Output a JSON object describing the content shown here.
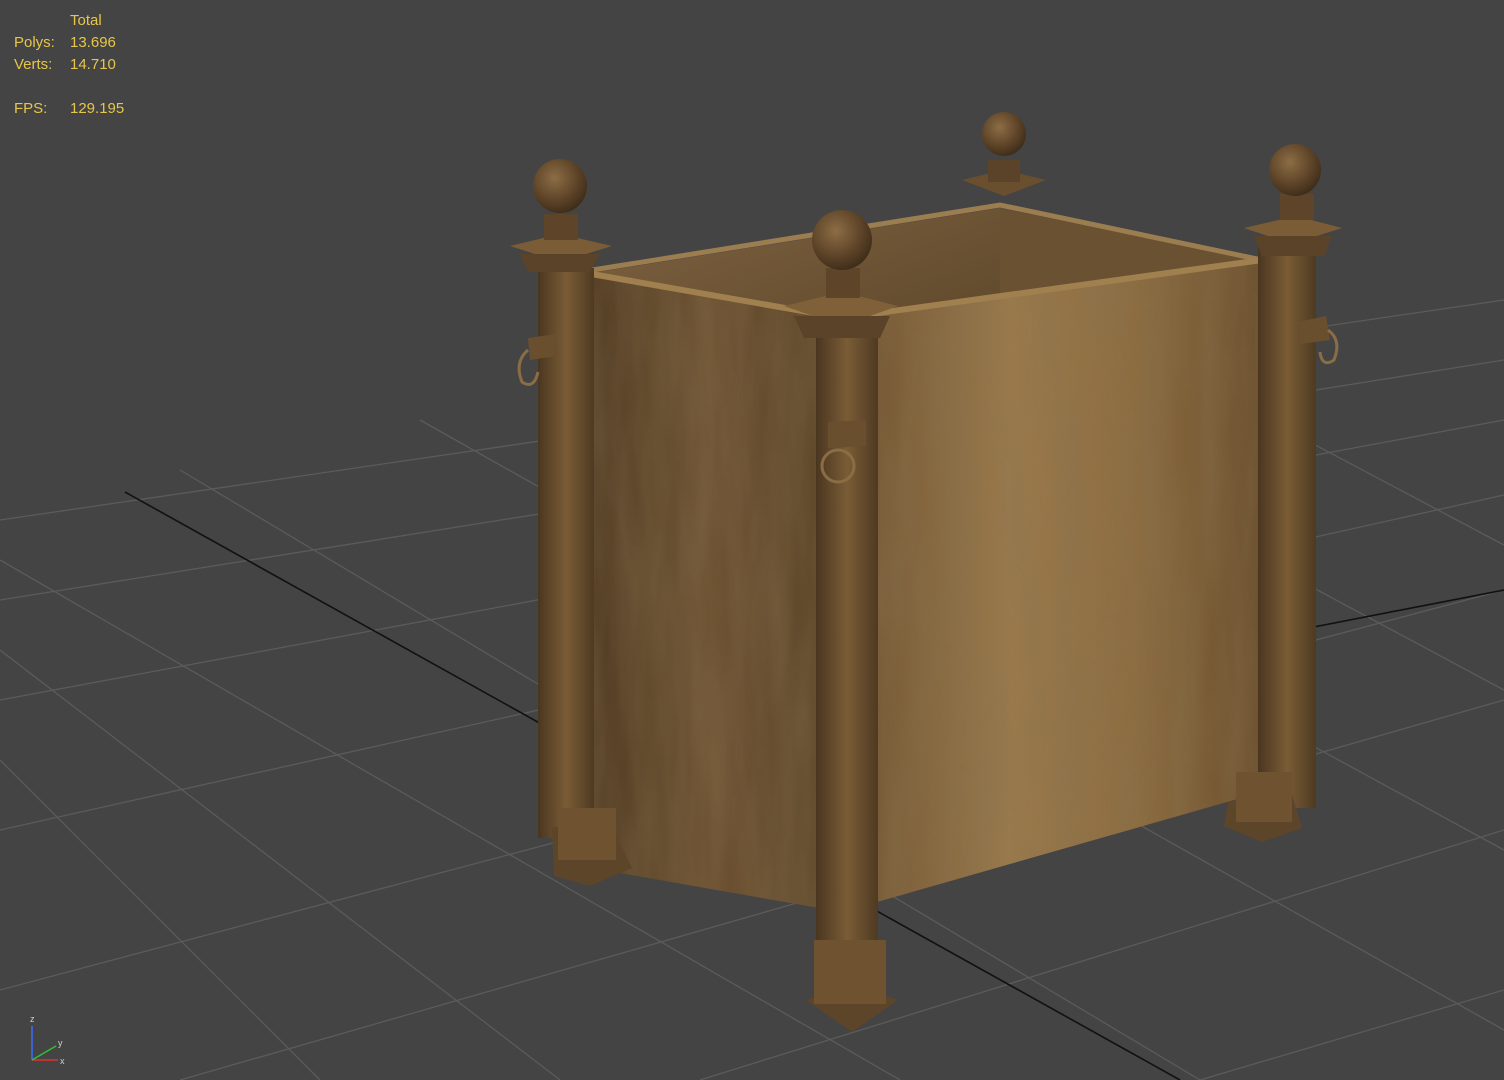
{
  "viewport": {
    "background": "#444444",
    "grid_color": "#5b5b5b",
    "grid_axis_color": "#111111",
    "text_color": "#e6c64a"
  },
  "stats": {
    "header": "Total",
    "polys_label": "Polys:",
    "polys_value": "13.696",
    "verts_label": "Verts:",
    "verts_value": "14.710",
    "fps_label": "FPS:",
    "fps_value": "129.195"
  },
  "axis_gizmo": {
    "z_label": "z",
    "x_label": "x",
    "y_label": "y",
    "icon": "axis-tripod-icon"
  },
  "model": {
    "object": "planter-box",
    "material_color": "#8b6a3e",
    "material_dark": "#5a4326"
  }
}
